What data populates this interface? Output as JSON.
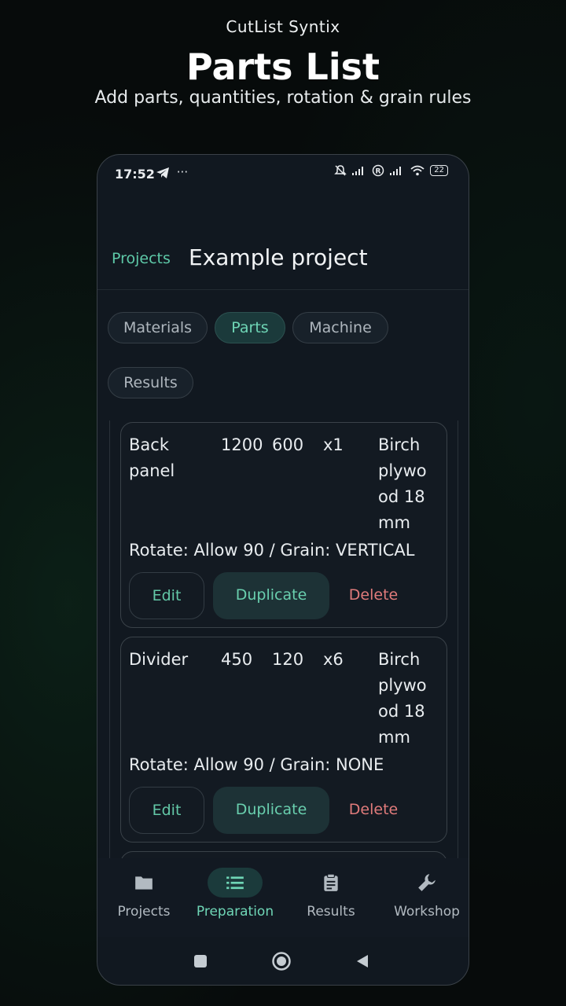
{
  "promo": {
    "app_name": "CutList Syntix",
    "title": "Parts List",
    "subtitle": "Add parts, quantities, rotation & grain rules"
  },
  "status_bar": {
    "time": "17:52",
    "left_icons": [
      "telegram-icon",
      "more-dots-icon"
    ],
    "right_icons": [
      "muted-bell-icon",
      "signal-icon",
      "registered-icon",
      "signal-icon",
      "wifi-icon"
    ],
    "battery": "22"
  },
  "app_bar": {
    "back_label": "Projects",
    "title": "Example project"
  },
  "tabs": [
    {
      "label": "Materials",
      "active": false
    },
    {
      "label": "Parts",
      "active": true
    },
    {
      "label": "Machine",
      "active": false
    },
    {
      "label": "Results",
      "active": false
    }
  ],
  "parts": [
    {
      "name": "Back panel",
      "length": "1200",
      "width": "600",
      "quantity": "x1",
      "material": "Birch plywood 18mm",
      "rules": "Rotate: Allow 90 / Grain: VERTICAL",
      "edit_label": "Edit",
      "duplicate_label": "Duplicate",
      "delete_label": "Delete"
    },
    {
      "name": "Divider",
      "length": "450",
      "width": "120",
      "quantity": "x6",
      "material": "Birch plywood 18mm",
      "rules": "Rotate: Allow 90 / Grain: NONE",
      "edit_label": "Edit",
      "duplicate_label": "Duplicate",
      "delete_label": "Delete"
    }
  ],
  "bottom_nav": [
    {
      "label": "Projects",
      "icon": "folder-icon",
      "active": false
    },
    {
      "label": "Preparation",
      "icon": "list-icon",
      "active": true
    },
    {
      "label": "Results",
      "icon": "clipboard-icon",
      "active": false
    },
    {
      "label": "Workshop",
      "icon": "wrench-icon",
      "active": false
    }
  ],
  "colors": {
    "accent": "#6fd6b6",
    "delete": "#e07b7b",
    "background": "#111820"
  }
}
